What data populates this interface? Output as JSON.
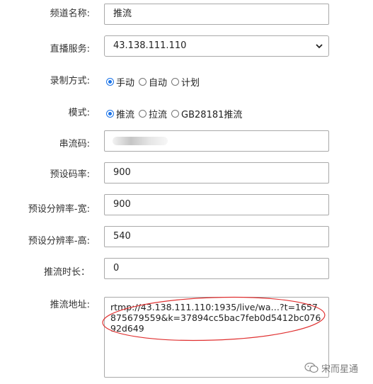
{
  "form": {
    "channel_name": {
      "label": "频道名称:",
      "value": "推流"
    },
    "live_service": {
      "label": "直播服务:",
      "value": "43.138.111.110"
    },
    "record_mode": {
      "label": "录制方式:",
      "options": [
        "手动",
        "自动",
        "计划"
      ],
      "selected": "手动"
    },
    "mode": {
      "label": "模式:",
      "options": [
        "推流",
        "拉流",
        "GB28181推流"
      ],
      "selected": "推流"
    },
    "stream_code": {
      "label": "串流码:",
      "value": ""
    },
    "preset_bitrate": {
      "label": "预设码率:",
      "value": "900"
    },
    "preset_width": {
      "label": "预设分辨率-宽:",
      "value": "900"
    },
    "preset_height": {
      "label": "预设分辨率-高:",
      "value": "540"
    },
    "push_duration": {
      "label": "推流时长：",
      "value": "0"
    },
    "push_url": {
      "label": "推流地址:",
      "value": "rtmp://43.138.111.110:1935/live/wa…?t=1657875679559&k=37894cc5bac7feb0d5412bc07692d649"
    }
  },
  "annotation": {
    "color": "#e03030"
  },
  "watermark": {
    "text": "宋而星通"
  },
  "colors": {
    "accent": "#1a73e8",
    "border": "#a9a9a9"
  }
}
